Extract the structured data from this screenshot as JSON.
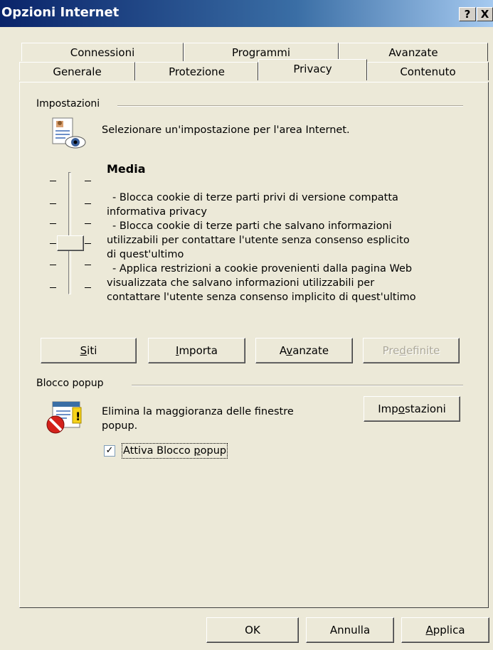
{
  "window": {
    "title": "Opzioni Internet",
    "help_btn": "?",
    "close_btn": "X"
  },
  "tabs_back": [
    "Connessioni",
    "Programmi",
    "Avanzate"
  ],
  "tabs_front": [
    "Generale",
    "Protezione",
    "Privacy",
    "Contenuto"
  ],
  "active_tab": "Privacy",
  "settings": {
    "group_label": "Impostazioni",
    "intro": "Selezionare un'impostazione per l'area Internet.",
    "level": "Media",
    "desc1a": "- Blocca cookie di terze parti privi di versione compatta",
    "desc1b": "informativa privacy",
    "desc2a": "- Blocca cookie di terze parti che salvano informazioni",
    "desc2b": "utilizzabili per contattare l'utente senza consenso esplicito",
    "desc2c": "di quest'ultimo",
    "desc3a": "- Applica restrizioni a cookie provenienti dalla pagina Web",
    "desc3b": "visualizzata che salvano informazioni utilizzabili per",
    "desc3c": "contattare l'utente senza consenso implicito di quest'ultimo",
    "buttons": {
      "siti_a": "S",
      "siti_b": "i",
      "siti_c": "ti",
      "importa_a": "I",
      "importa_b": "mporta",
      "avanzate_a": "A",
      "avanzate_b": "v",
      "avanzate_c": "anzate",
      "predef_a": "Pre",
      "predef_b": "d",
      "predef_c": "efinite"
    }
  },
  "popup": {
    "group_label": "Blocco popup",
    "desc_line1": "Elimina la maggioranza delle finestre",
    "desc_line2": "popup.",
    "settings_a": "Imp",
    "settings_b": "o",
    "settings_c": "stazioni",
    "checkbox_a": "Attiva Blocco ",
    "checkbox_b": "p",
    "checkbox_c": "opup",
    "checked": true
  },
  "footer": {
    "ok": "OK",
    "annulla": "Annulla",
    "applica_a": "A",
    "applica_b": "pplica"
  }
}
